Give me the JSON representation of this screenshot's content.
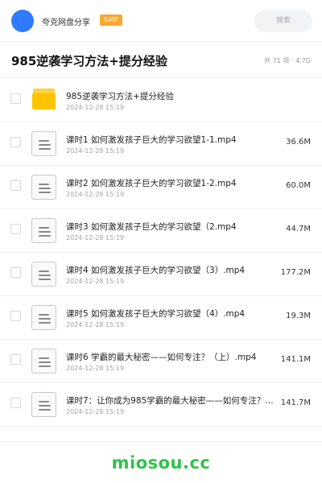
{
  "header": {
    "site_name": "夸克网盘分享",
    "vip_label": "SVIP",
    "search_placeholder": "搜索"
  },
  "folder": {
    "title": "985逆袭学习方法+提分经验",
    "summary": "共 71 项 · 4.7G"
  },
  "items": [
    {
      "type": "folder",
      "name": "985逆袭学习方法+提分经验",
      "date": "2024-12-28 15:19",
      "size": ""
    },
    {
      "type": "file",
      "name": "课时1 如何激发孩子巨大的学习欲望1-1.mp4",
      "date": "2024-12-28 15:19",
      "size": "36.6M"
    },
    {
      "type": "file",
      "name": "课时2 如何激发孩子巨大的学习欲望1-2.mp4",
      "date": "2024-12-28 15:19",
      "size": "60.0M"
    },
    {
      "type": "file",
      "name": "课时3 如何激发孩子巨大的学习欲望（2.mp4",
      "date": "2024-12-28 15:19",
      "size": "44.7M"
    },
    {
      "type": "file",
      "name": "课时4 如何激发孩子巨大的学习欲望（3）.mp4",
      "date": "2024-12-28 15:19",
      "size": "177.2M"
    },
    {
      "type": "file",
      "name": "课时5 如何激发孩子巨大的学习欲望（4）.mp4",
      "date": "2024-12-28 15:19",
      "size": "19.3M"
    },
    {
      "type": "file",
      "name": "课时6 学霸的最大秘密——如何专注？（上）.mp4",
      "date": "2024-12-28 15:19",
      "size": "141.1M"
    },
    {
      "type": "file",
      "name": "课时7：让你成为985学霸的最大秘密——如何专注？…",
      "date": "2024-12-28 15:19",
      "size": "141.7M"
    }
  ],
  "watermark": "miosou.cc",
  "colors": {
    "avatar": "#2f7bff",
    "vip_badge": "#f7a733",
    "folder_icon": "#ffc400",
    "watermark": "#2fc24a"
  }
}
